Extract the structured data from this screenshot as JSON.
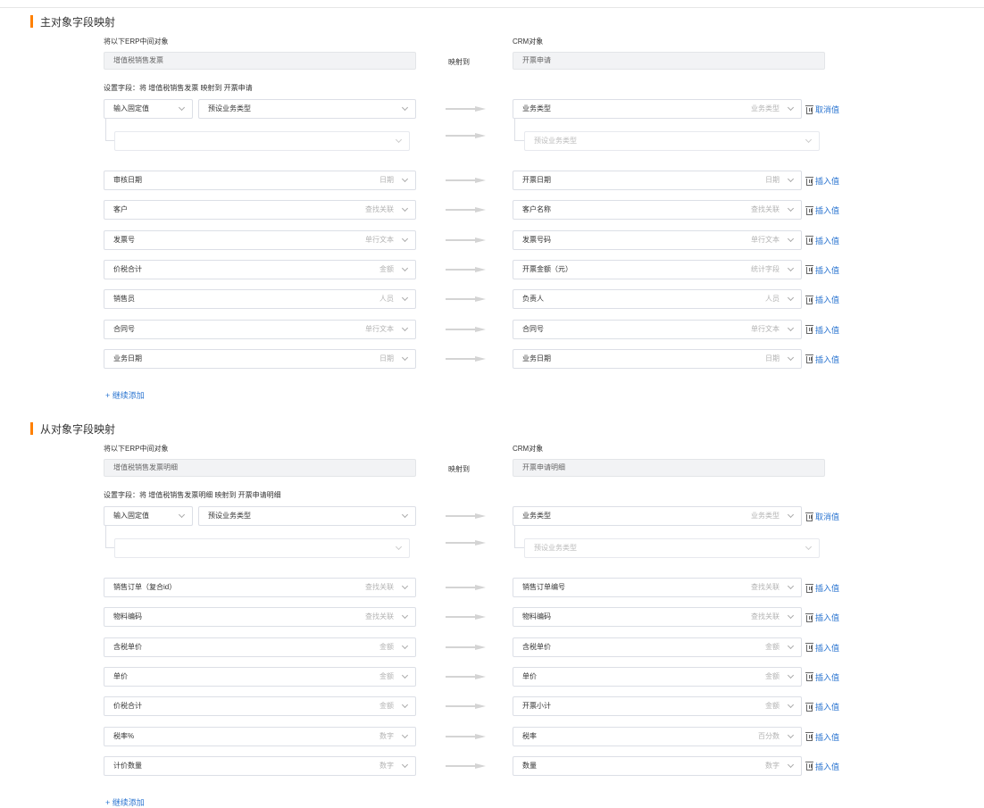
{
  "sections": [
    {
      "title": "主对象字段映射",
      "erp_label": "将以下ERP中间对象",
      "crm_label": "CRM对象",
      "erp_object": "增值税销售发票",
      "map_to": "映射到",
      "crm_object": "开票申请",
      "setting": "设置字段：将 增值税销售发票 映射到 开票申请",
      "fixed_select": "输入固定值",
      "preset_select": "预设业务类型",
      "crm_type_field": "业务类型",
      "crm_type_kind": "业务类型",
      "cancel_label": "取消值",
      "preset_placeholder": "预设业务类型",
      "rows": [
        {
          "erp": "审核日期",
          "erp_type": "日期",
          "crm": "开票日期",
          "crm_type": "日期",
          "action": "插入值"
        },
        {
          "erp": "客户",
          "erp_type": "查找关联",
          "crm": "客户名称",
          "crm_type": "查找关联",
          "action": "插入值"
        },
        {
          "erp": "发票号",
          "erp_type": "单行文本",
          "crm": "发票号码",
          "crm_type": "单行文本",
          "action": "插入值"
        },
        {
          "erp": "价税合计",
          "erp_type": "金额",
          "crm": "开票金额（元）",
          "crm_type": "统计字段",
          "action": "插入值"
        },
        {
          "erp": "销售员",
          "erp_type": "人员",
          "crm": "负责人",
          "crm_type": "人员",
          "action": "插入值"
        },
        {
          "erp": "合同号",
          "erp_type": "单行文本",
          "crm": "合同号",
          "crm_type": "单行文本",
          "action": "插入值"
        },
        {
          "erp": "业务日期",
          "erp_type": "日期",
          "crm": "业务日期",
          "crm_type": "日期",
          "action": "插入值"
        }
      ],
      "add_label": "+ 继续添加"
    },
    {
      "title": "从对象字段映射",
      "erp_label": "将以下ERP中间对象",
      "crm_label": "CRM对象",
      "erp_object": "增值税销售发票明细",
      "map_to": "映射到",
      "crm_object": "开票申请明细",
      "setting": "设置字段：将 增值税销售发票明细 映射到 开票申请明细",
      "fixed_select": "输入固定值",
      "preset_select": "预设业务类型",
      "crm_type_field": "业务类型",
      "crm_type_kind": "业务类型",
      "cancel_label": "取消值",
      "preset_placeholder": "预设业务类型",
      "rows": [
        {
          "erp": "销售订单（复合id）",
          "erp_type": "查找关联",
          "crm": "销售订单编号",
          "crm_type": "查找关联",
          "action": "插入值"
        },
        {
          "erp": "物料编码",
          "erp_type": "查找关联",
          "crm": "物料编码",
          "crm_type": "查找关联",
          "action": "插入值"
        },
        {
          "erp": "含税单价",
          "erp_type": "金额",
          "crm": "含税单价",
          "crm_type": "金额",
          "action": "插入值"
        },
        {
          "erp": "单价",
          "erp_type": "金额",
          "crm": "单价",
          "crm_type": "金额",
          "action": "插入值"
        },
        {
          "erp": "价税合计",
          "erp_type": "金额",
          "crm": "开票小计",
          "crm_type": "金额",
          "action": "插入值"
        },
        {
          "erp": "税率%",
          "erp_type": "数字",
          "crm": "税率",
          "crm_type": "百分数",
          "action": "插入值"
        },
        {
          "erp": "计价数量",
          "erp_type": "数字",
          "crm": "数量",
          "crm_type": "数字",
          "action": "插入值"
        }
      ],
      "add_label": "+ 继续添加"
    }
  ]
}
